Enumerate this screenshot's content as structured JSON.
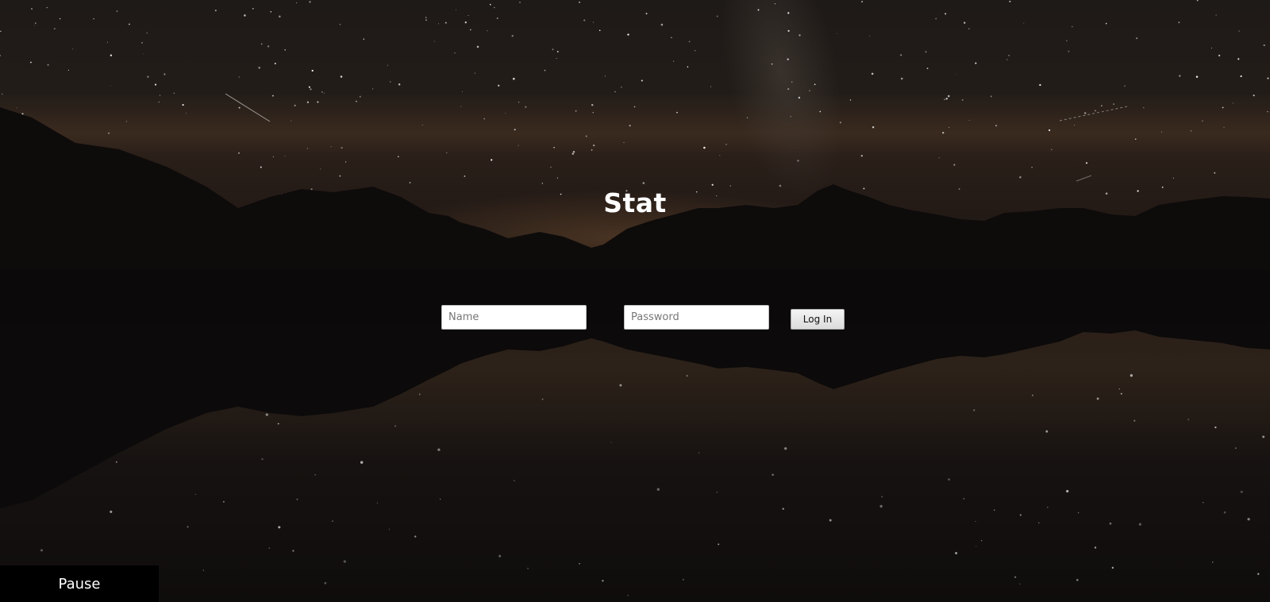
{
  "app": {
    "title": "Stat"
  },
  "login": {
    "name_placeholder": "Name",
    "name_value": "",
    "password_placeholder": "Password",
    "password_value": "",
    "submit_label": "Log In"
  },
  "background": {
    "description_icon": "night-sky-lake-mountains-image",
    "sky_color": "#1f1a17",
    "horizon_glow": "#4a3423",
    "mountain_color": "#0d0a0a",
    "water_color": "#110e0e"
  },
  "video_control": {
    "pause_label": "Pause"
  }
}
